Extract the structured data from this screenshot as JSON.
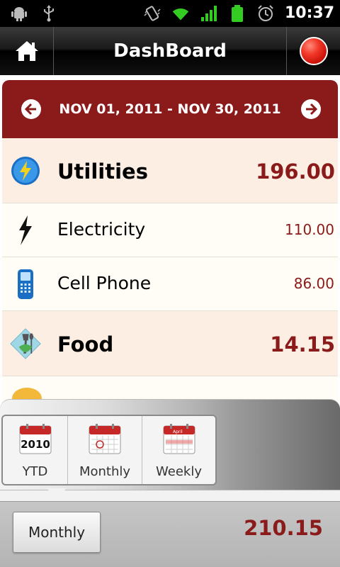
{
  "status_bar": {
    "left_icons": [
      "android-debug-icon",
      "usb-icon"
    ],
    "right_icons": [
      "vibrate-icon",
      "wifi-icon",
      "signal-icon",
      "battery-icon",
      "alarm-icon"
    ],
    "time": "10:37"
  },
  "title_bar": {
    "title": "DashBoard",
    "home_icon": "home-icon",
    "record_icon": "record-icon"
  },
  "date_range": {
    "label": "NOV 01, 2011 - NOV 30, 2011",
    "prev_icon": "arrow-left-icon",
    "next_icon": "arrow-right-icon"
  },
  "list": {
    "rows": [
      {
        "type": "category",
        "icon": "utilities-icon",
        "label": "Utilities",
        "amount": "196.00"
      },
      {
        "type": "item",
        "icon": "lightning-icon",
        "label": "Electricity",
        "amount": "110.00"
      },
      {
        "type": "item",
        "icon": "cell-phone-icon",
        "label": "Cell Phone",
        "amount": "86.00"
      },
      {
        "type": "category",
        "icon": "food-icon",
        "label": "Food",
        "amount": "14.15"
      }
    ]
  },
  "period_selector": {
    "options": [
      {
        "label": "YTD",
        "icon_text": "2010",
        "icon": "calendar-year-icon"
      },
      {
        "label": "Monthly",
        "icon_text": "",
        "icon": "calendar-month-icon"
      },
      {
        "label": "Weekly",
        "icon_text": "April",
        "icon": "calendar-week-icon"
      }
    ]
  },
  "bottom_bar": {
    "period_button": "Monthly",
    "total": "210.15"
  },
  "colors": {
    "accent": "#8b1a1a",
    "category_bg": "#fdeee3",
    "item_bg": "#fffdf6"
  }
}
